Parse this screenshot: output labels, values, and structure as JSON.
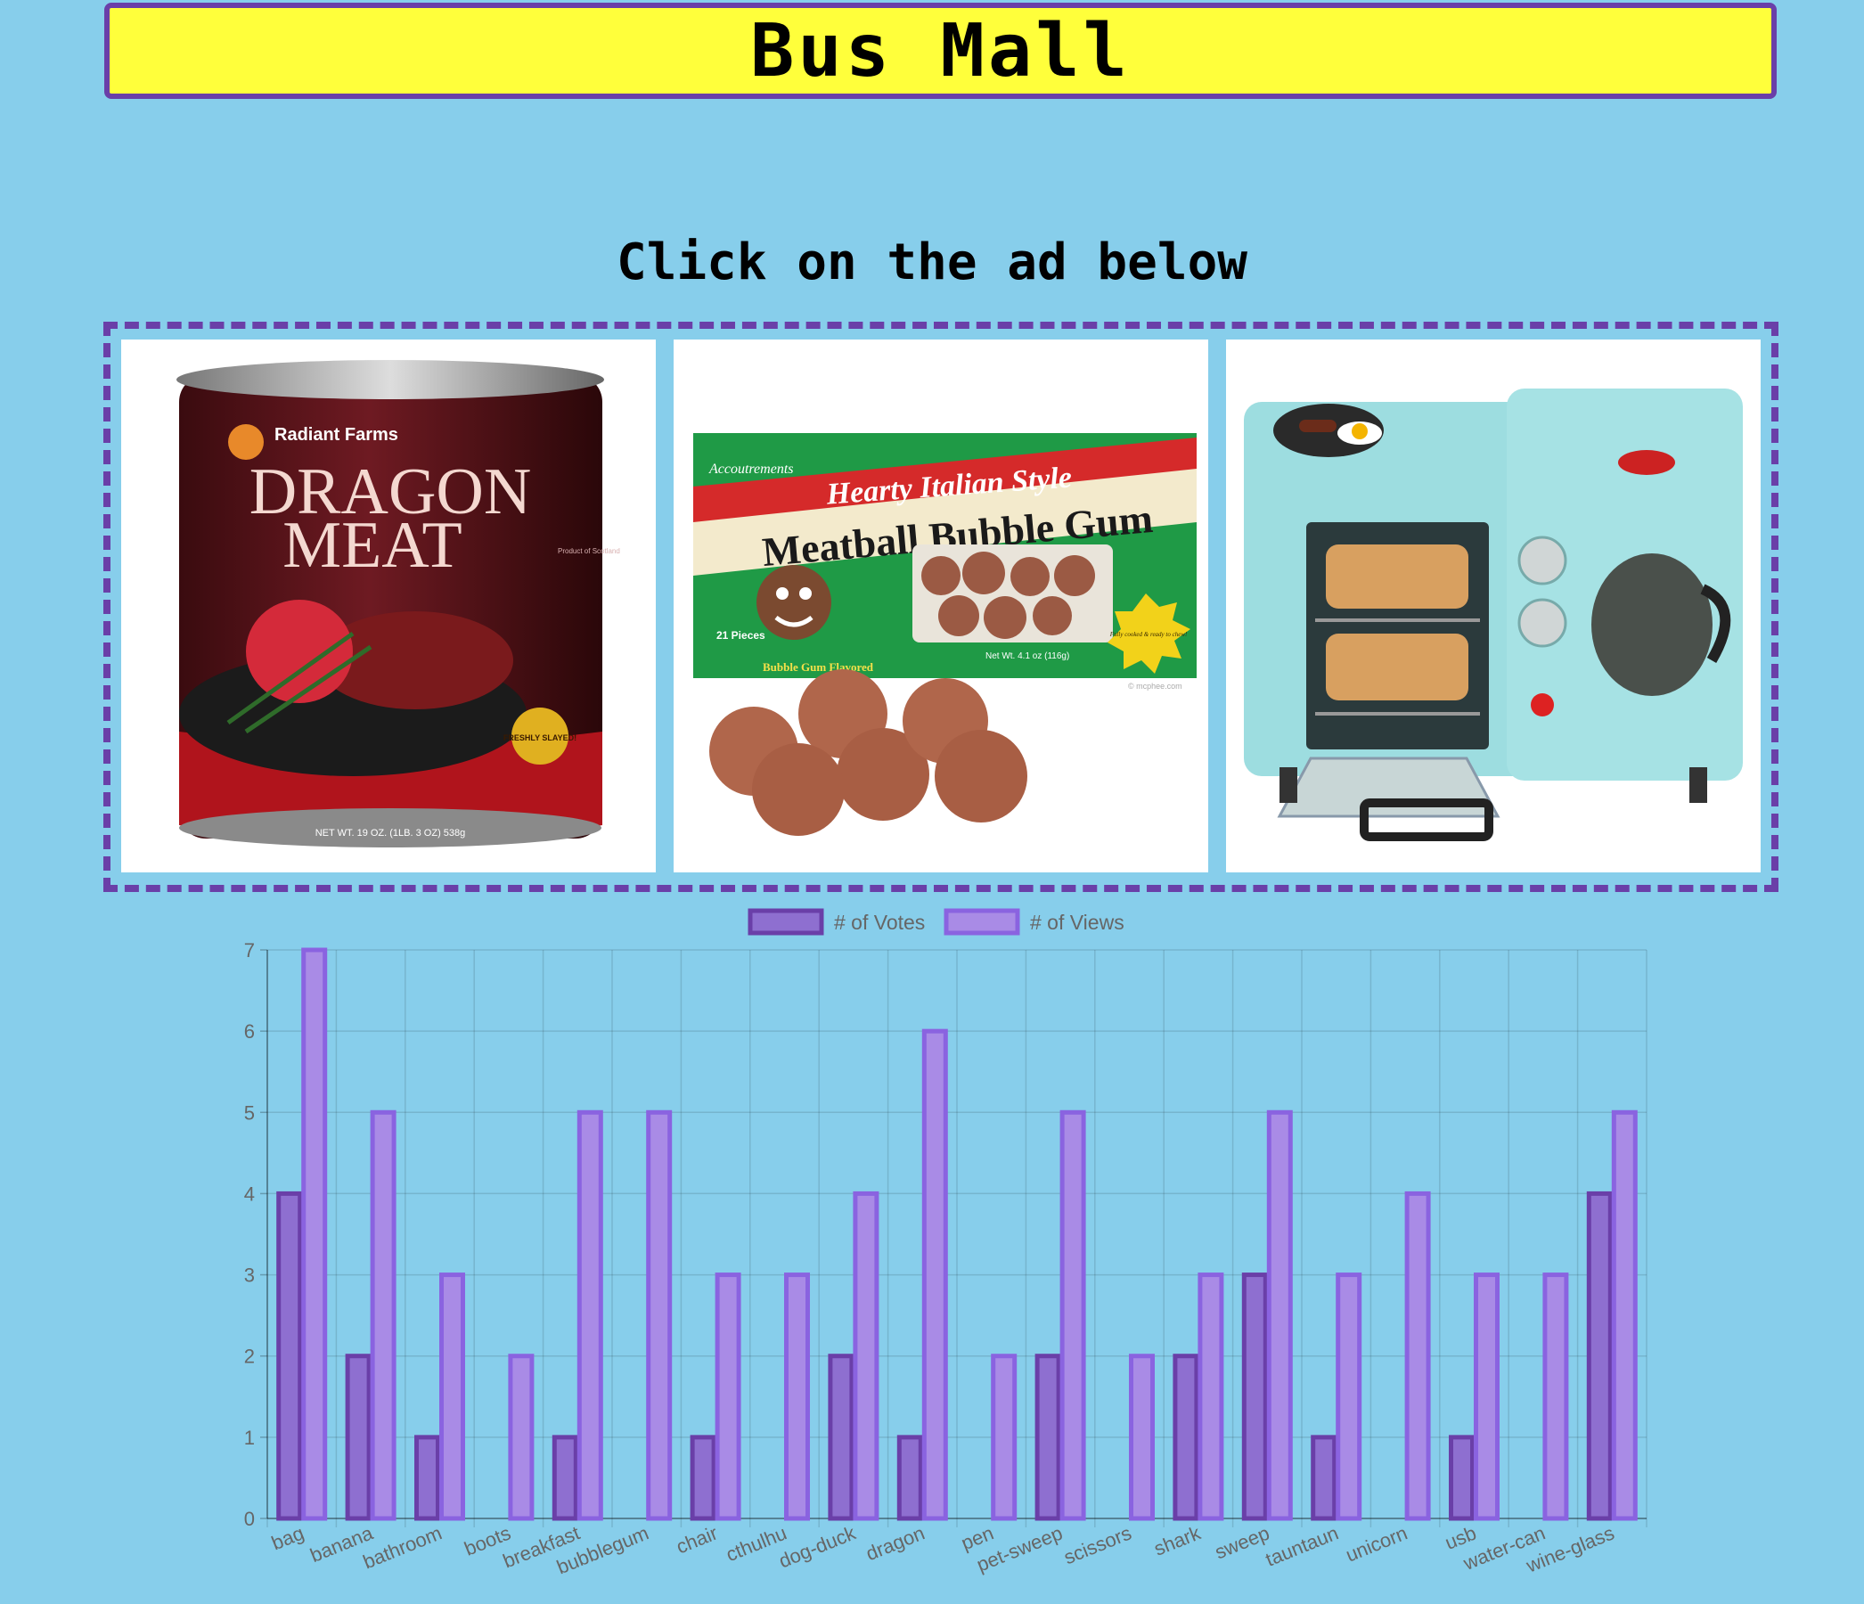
{
  "header": {
    "title": "Bus Mall"
  },
  "instructions": "Click on the ad below",
  "ads": [
    {
      "name": "dragon",
      "brand": "Radiant Farms",
      "line1": "DRAGON",
      "line2": "MEAT",
      "small": "Product of Scotland",
      "badge": "FRESHLY SLAYED!",
      "weight": "NET WT. 19 OZ. (1LB. 3 OZ) 538g"
    },
    {
      "name": "bubblegum",
      "brand": "Accoutrements",
      "line1": "Hearty Italian Style",
      "line2": "Meatball Bubble Gum",
      "pieces": "21 Pieces",
      "flavor": "Bubble Gum Flavored",
      "net": "Net Wt. 4.1 oz (116g)",
      "burst": "Fully cooked & ready to chew!",
      "credit": "© mcphee.com"
    },
    {
      "name": "breakfast"
    }
  ],
  "colors": {
    "background": "#87ceeb",
    "header_bg": "#ffff3b",
    "accent": "#6a3fa8",
    "votes_fill": "#8e6fd0",
    "votes_border": "#6a3fa8",
    "views_fill": "#a98be6",
    "views_border": "#8a63e0"
  },
  "chart_data": {
    "type": "bar",
    "categories": [
      "bag",
      "banana",
      "bathroom",
      "boots",
      "breakfast",
      "bubblegum",
      "chair",
      "cthulhu",
      "dog-duck",
      "dragon",
      "pen",
      "pet-sweep",
      "scissors",
      "shark",
      "sweep",
      "tauntaun",
      "unicorn",
      "usb",
      "water-can",
      "wine-glass"
    ],
    "series": [
      {
        "name": "# of Votes",
        "values": [
          4,
          2,
          1,
          0,
          1,
          0,
          1,
          0,
          2,
          1,
          0,
          2,
          0,
          2,
          3,
          1,
          0,
          1,
          0,
          4
        ]
      },
      {
        "name": "# of Views",
        "values": [
          7,
          5,
          3,
          2,
          5,
          5,
          3,
          3,
          4,
          6,
          2,
          5,
          2,
          3,
          5,
          3,
          4,
          3,
          3,
          5
        ]
      }
    ],
    "ylim": [
      0,
      7
    ],
    "yticks": [
      0,
      1,
      2,
      3,
      4,
      5,
      6,
      7
    ],
    "grid": true,
    "legend": "top"
  }
}
